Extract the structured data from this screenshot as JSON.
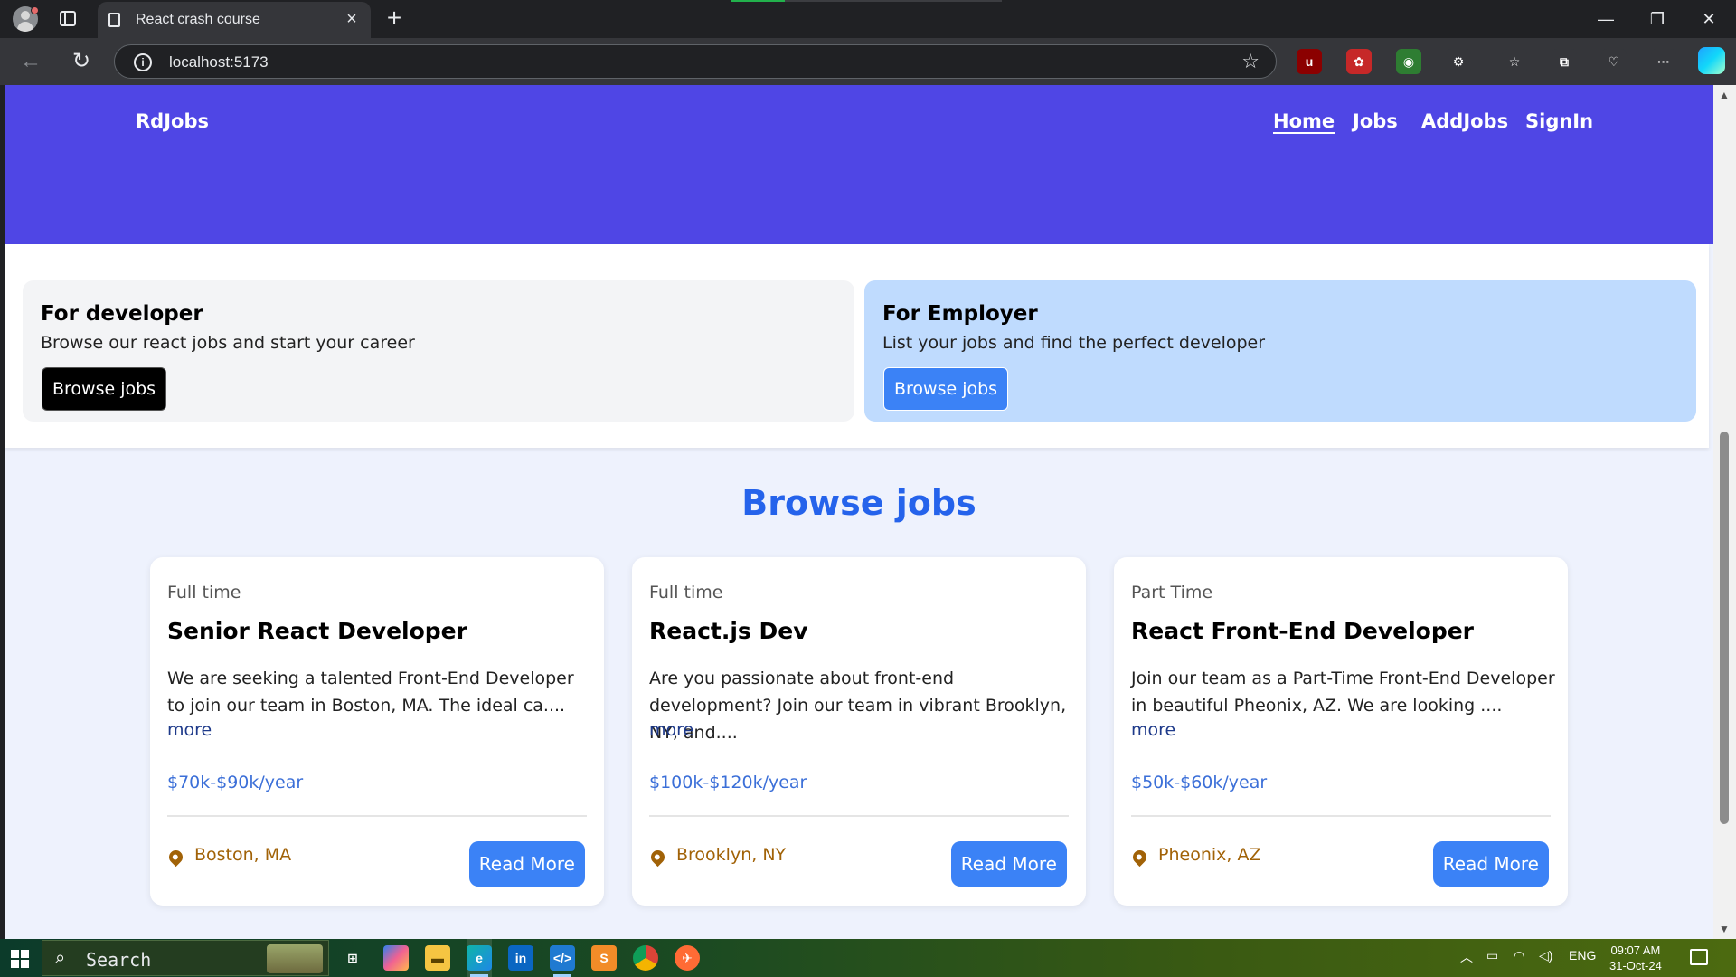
{
  "browser": {
    "tab_title": "React crash course",
    "url": "localhost:5173",
    "close_tab": "×",
    "new_tab": "+",
    "minimize": "—",
    "maximize": "❐",
    "close": "✕",
    "extensions": [
      {
        "name": "ublock-icon",
        "label": "u",
        "color": "#8b0000"
      },
      {
        "name": "extension-red-icon",
        "label": "✿",
        "color": "#c62828"
      },
      {
        "name": "extension-globe-icon",
        "label": "◉",
        "color": "#2e7d32"
      },
      {
        "name": "extensions-puzzle-icon",
        "label": "⚙",
        "color": "#35363a"
      },
      {
        "name": "favorites-icon",
        "label": "☆",
        "color": "#35363a"
      },
      {
        "name": "collections-icon",
        "label": "⧉",
        "color": "#35363a"
      },
      {
        "name": "performance-icon",
        "label": "♡",
        "color": "#35363a"
      },
      {
        "name": "more-menu-icon",
        "label": "···",
        "color": "#35363a"
      }
    ]
  },
  "site": {
    "brand": "RdJobs",
    "nav": [
      {
        "label": "Home",
        "active": true
      },
      {
        "label": "Jobs",
        "active": false
      },
      {
        "label": "AddJobs",
        "active": false
      },
      {
        "label": "SignIn",
        "active": false
      }
    ],
    "developer_card": {
      "title": "For developer",
      "text": "Browse our react jobs and start your career",
      "button": "Browse jobs",
      "bg": "#f3f4f6"
    },
    "employer_card": {
      "title": "For Employer",
      "text": "List your jobs and find the perfect developer",
      "button": "Browse jobs",
      "bg": "#bfdbfe"
    },
    "browse_title": "Browse jobs",
    "jobs": [
      {
        "type": "Full time",
        "title": "Senior React Developer",
        "description": "We are seeking a talented Front-End Developer to join our team in Boston, MA. The ideal ca....",
        "more": "more",
        "salary": "$70k-$90k/year",
        "location": "Boston, MA",
        "button": "Read More"
      },
      {
        "type": "Full time",
        "title": "React.js Dev",
        "description": "Are you passionate about front-end development? Join our team in vibrant Brooklyn, NY, and....",
        "more": "more",
        "salary": "$100k-$120k/year",
        "location": "Brooklyn, NY",
        "button": "Read More"
      },
      {
        "type": "Part Time",
        "title": "React Front-End Developer",
        "description": "Join our team as a Part-Time Front-End Developer in beautiful Pheonix, AZ. We are looking ....",
        "more": "more",
        "salary": "$50k-$60k/year",
        "location": "Pheonix, AZ",
        "button": "Read More"
      }
    ]
  },
  "taskbar": {
    "search_placeholder": "Search",
    "language": "ENG",
    "time": "09:07 AM",
    "date": "31-Oct-24"
  }
}
